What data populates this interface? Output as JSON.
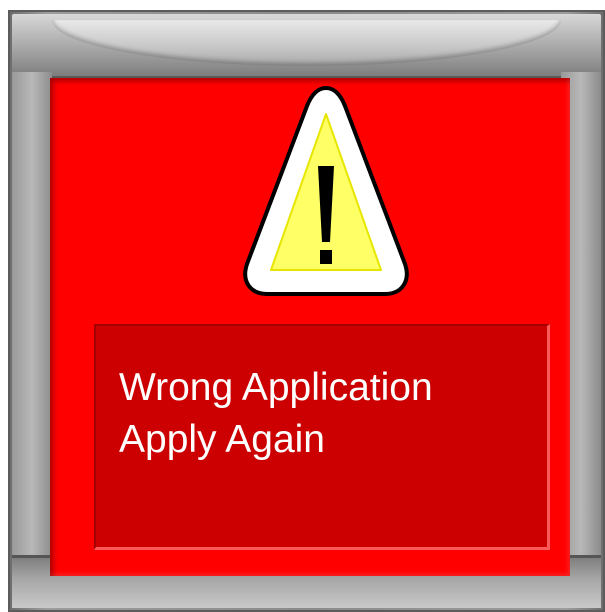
{
  "dialog": {
    "icon": "warning-triangle-icon",
    "message_line1": "Wrong Application",
    "message_line2": "Apply Again"
  },
  "colors": {
    "panel_background": "#ff0000",
    "message_background": "#cc0000",
    "warning_fill": "#ffff66",
    "frame": "#8a8a8a"
  }
}
